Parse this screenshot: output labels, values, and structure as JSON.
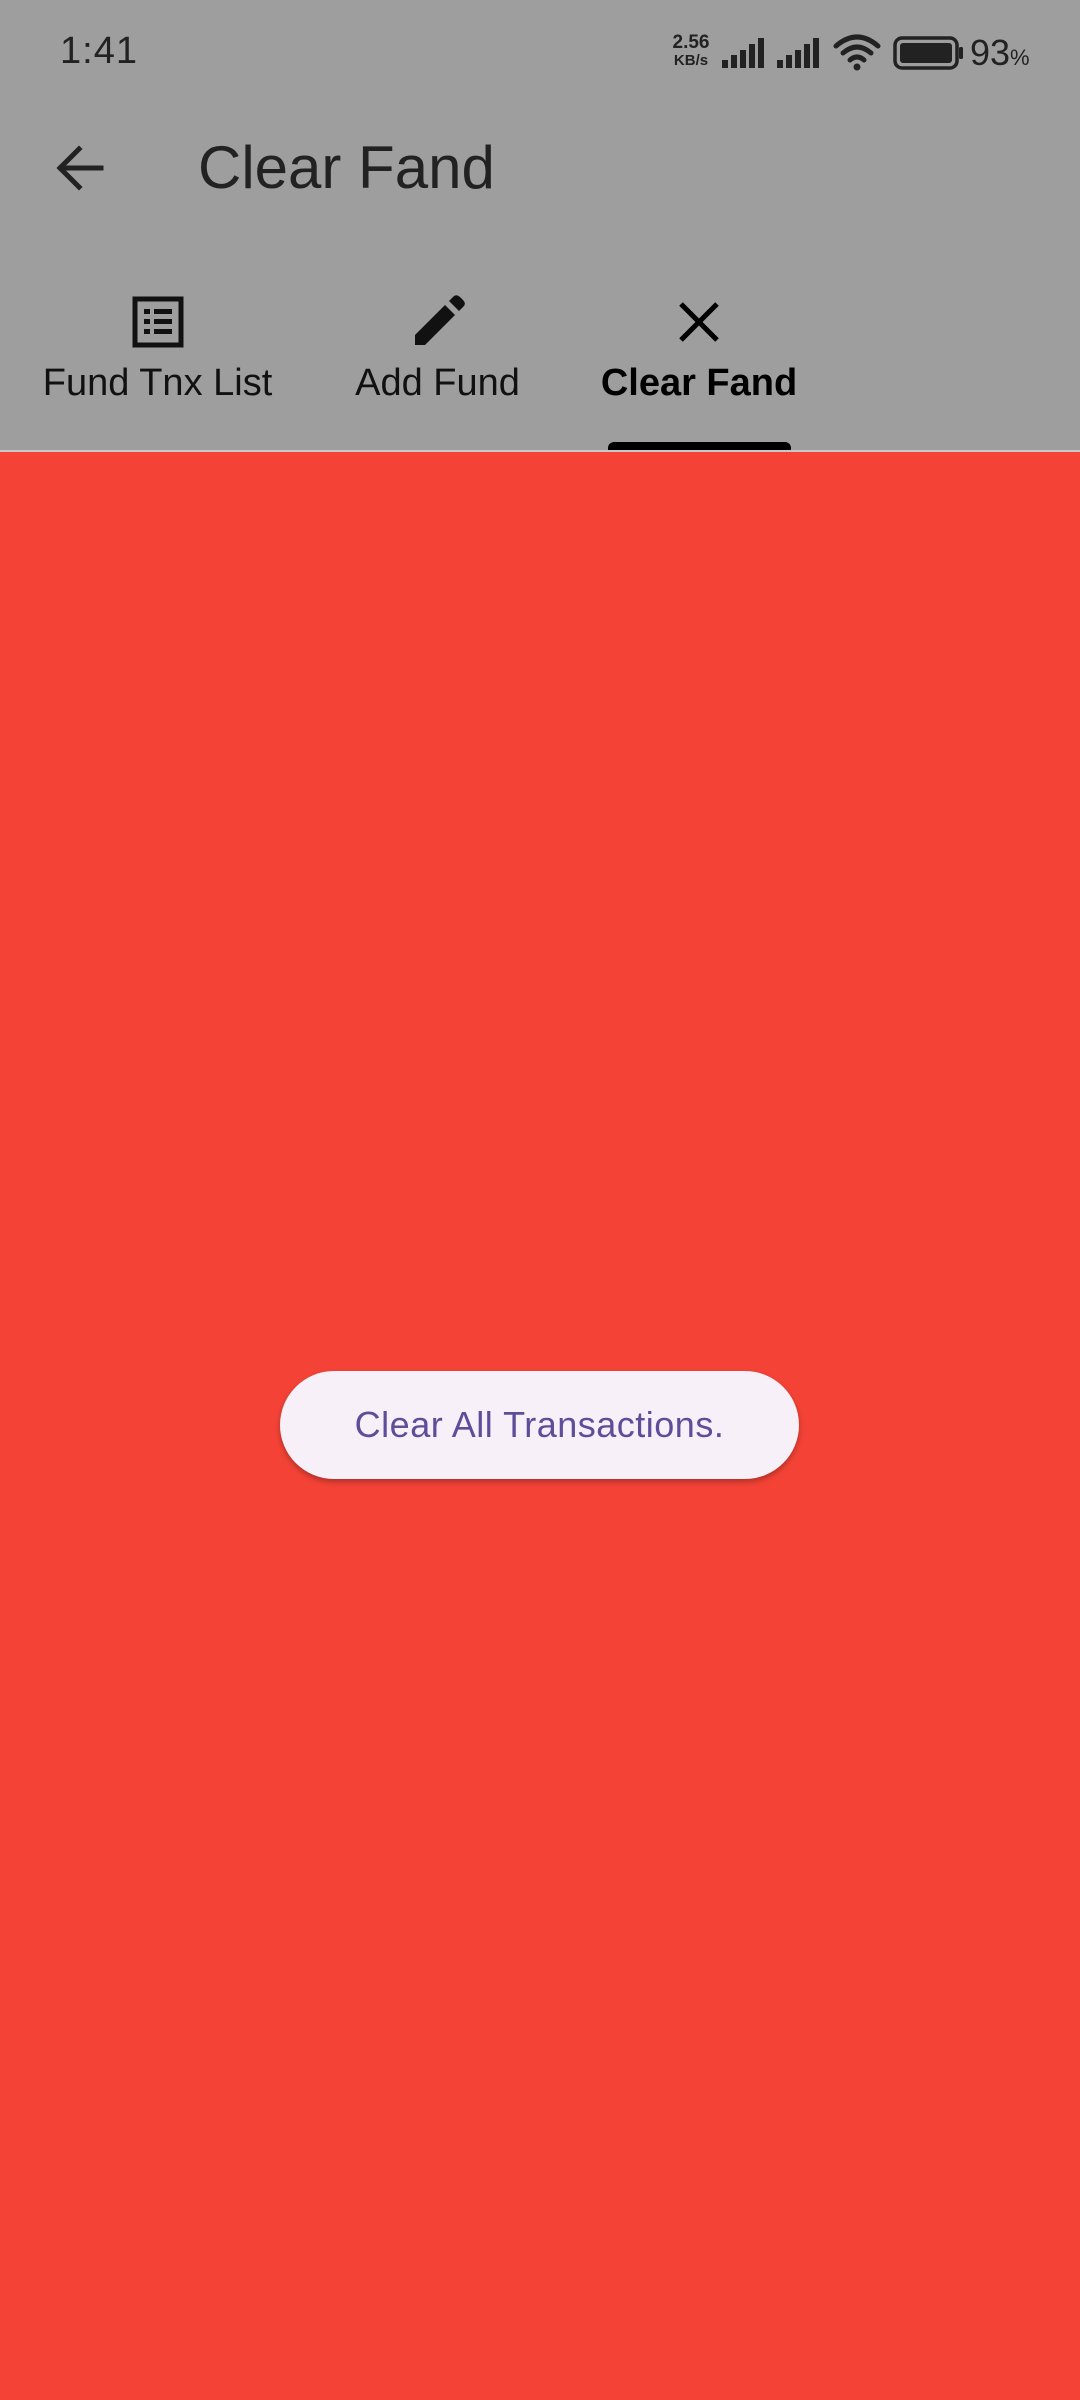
{
  "status_bar": {
    "time": "1:41",
    "net_speed_value": "2.56",
    "net_speed_unit": "KB/s",
    "battery_level": "93",
    "battery_unit": "%",
    "icons": [
      "signal-icon",
      "signal-icon",
      "wifi-icon",
      "battery-icon"
    ]
  },
  "app_bar": {
    "back_icon": "arrow-left-icon",
    "title": "Clear Fand"
  },
  "tabs": [
    {
      "label": "Fund Tnx List",
      "icon": "list-icon",
      "active": false
    },
    {
      "label": "Add Fund",
      "icon": "pencil-icon",
      "active": false
    },
    {
      "label": "Clear Fand",
      "icon": "close-icon",
      "active": true
    }
  ],
  "main": {
    "clear_button_label": "Clear All Transactions."
  },
  "colors": {
    "chrome_background": "#9e9e9e",
    "content_background": "#f44336",
    "button_background": "#f7f0f8",
    "button_text": "#5e4d99",
    "tab_indicator": "#000000"
  }
}
